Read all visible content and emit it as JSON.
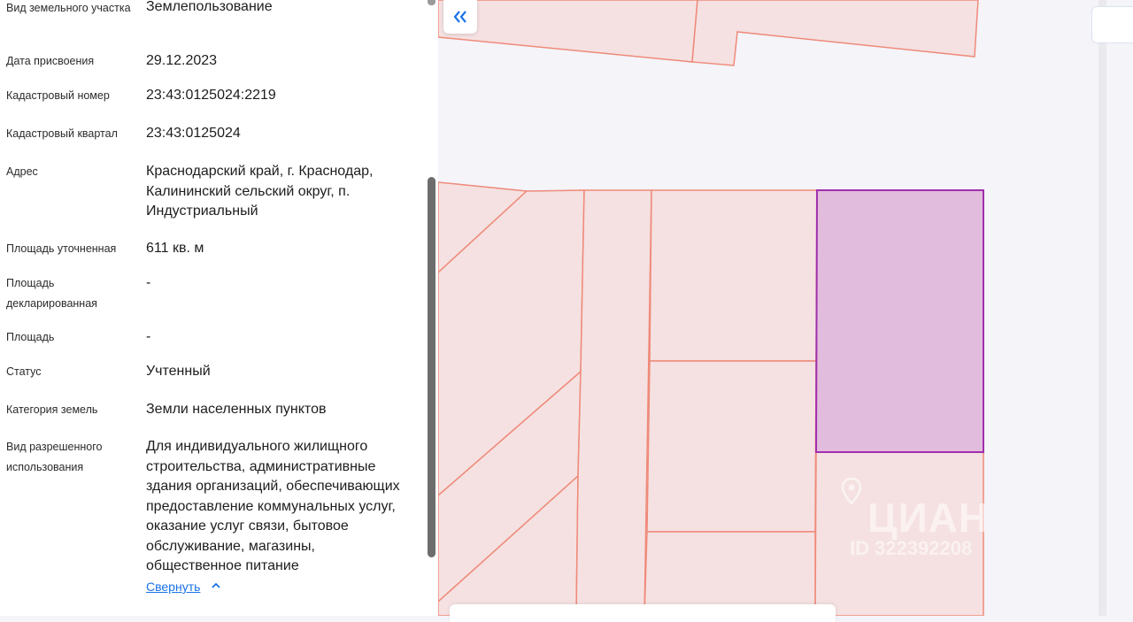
{
  "fields": [
    {
      "label": "Вид земельного участка",
      "value": "Землепользование"
    },
    {
      "label": "Дата присвоения",
      "value": "29.12.2023"
    },
    {
      "label": "Кадастровый номер",
      "value": "23:43:0125024:2219"
    },
    {
      "label": "Кадастровый квартал",
      "value": "23:43:0125024"
    },
    {
      "label": "Адрес",
      "value": "Краснодарский край, г. Краснодар, Калининский сельский округ, п. Индустриальный"
    },
    {
      "label": "Площадь уточненная",
      "value": "611 кв. м"
    },
    {
      "label": "Площадь декларированная",
      "value": "-"
    },
    {
      "label": "Площадь",
      "value": "-"
    },
    {
      "label": "Статус",
      "value": "Учтенный"
    },
    {
      "label": "Категория земель",
      "value": "Земли населенных пунктов"
    },
    {
      "label": "Вид разрешенного использования",
      "value": "Для индивидуального жилищного строительства, административные здания организаций, обеспечивающих предоставление коммунальных услуг, оказание услуг связи, бытовое обслуживание, магазины, общественное питание"
    }
  ],
  "collapse_link": "Свернуть",
  "icons": {
    "collapse_panel": "double-chevron-left-icon",
    "collapse_link": "chevron-up-icon"
  },
  "watermark": {
    "brand": "ЦИАН",
    "id": "ID 322392208"
  },
  "colors": {
    "accent": "#1a73e8",
    "parcel_fill": "#f5e1e1",
    "parcel_stroke": "#ef8a7a",
    "selected_fill": "#e2bcdc",
    "selected_stroke": "#a02fad"
  }
}
